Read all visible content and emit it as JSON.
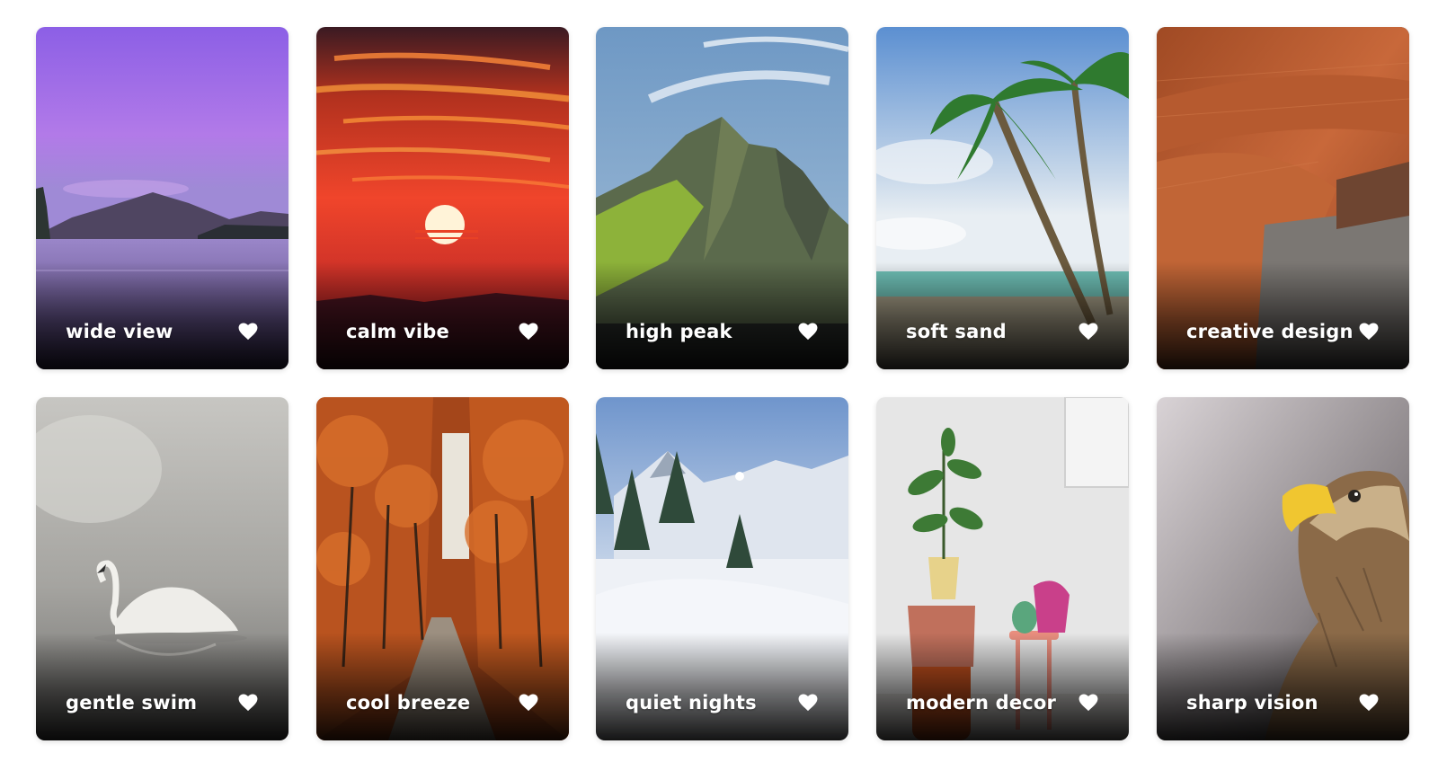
{
  "gallery": {
    "cards": [
      {
        "label": "wide view",
        "icon": "heart-icon"
      },
      {
        "label": "calm vibe",
        "icon": "heart-icon"
      },
      {
        "label": "high peak",
        "icon": "heart-icon"
      },
      {
        "label": "soft sand",
        "icon": "heart-icon"
      },
      {
        "label": "creative design",
        "icon": "heart-icon"
      },
      {
        "label": "gentle swim",
        "icon": "heart-icon"
      },
      {
        "label": "cool breeze",
        "icon": "heart-icon"
      },
      {
        "label": "quiet nights",
        "icon": "heart-icon"
      },
      {
        "label": "modern decor",
        "icon": "heart-icon"
      },
      {
        "label": "sharp vision",
        "icon": "heart-icon"
      }
    ]
  },
  "colors": {
    "caption_text": "#ffffff",
    "heart_fill": "#ffffff",
    "page_background": "#ffffff"
  }
}
